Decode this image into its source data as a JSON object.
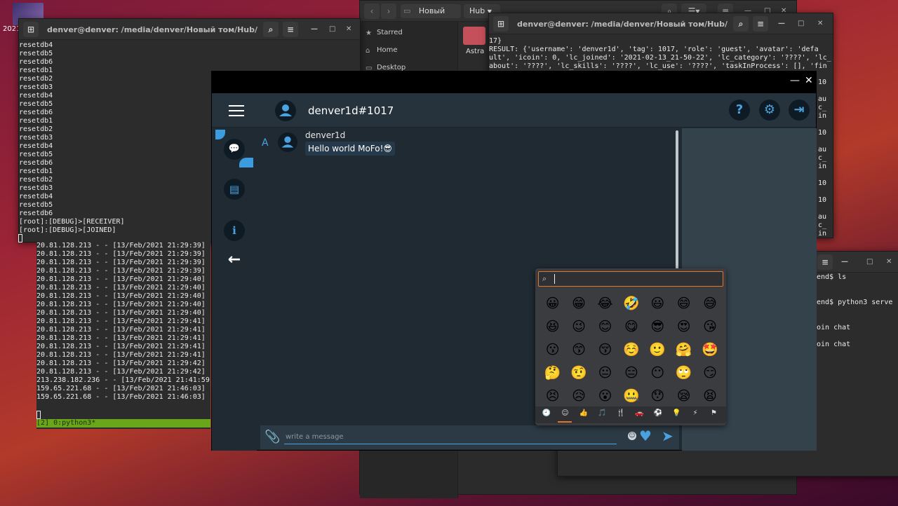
{
  "desktop": {
    "icon_label": "2021"
  },
  "terminal1": {
    "title": "denver@denver: /media/denver/Новый том/Hub/idenclin/cli...",
    "lines": [
      "resetdb4",
      "resetdb5",
      "resetdb6",
      "resetdb1",
      "resetdb2",
      "resetdb3",
      "resetdb4",
      "resetdb5",
      "resetdb6",
      "resetdb1",
      "resetdb2",
      "resetdb3",
      "resetdb4",
      "resetdb5",
      "resetdb6",
      "resetdb1",
      "resetdb2",
      "resetdb3",
      "resetdb4",
      "resetdb5",
      "resetdb6",
      "[root]:[DEBUG]>[RECEIVER]",
      "[root]:[DEBUG]>[JOINED]"
    ]
  },
  "terminal2": {
    "lines": [
      "20.81.128.213 - - [13/Feb/2021 21:29:39]",
      "20.81.128.213 - - [13/Feb/2021 21:29:39]",
      "20.81.128.213 - - [13/Feb/2021 21:29:39]",
      "20.81.128.213 - - [13/Feb/2021 21:29:39]",
      "20.81.128.213 - - [13/Feb/2021 21:29:40]",
      "20.81.128.213 - - [13/Feb/2021 21:29:40]",
      "20.81.128.213 - - [13/Feb/2021 21:29:40]",
      "20.81.128.213 - - [13/Feb/2021 21:29:40]",
      "20.81.128.213 - - [13/Feb/2021 21:29:40]",
      "20.81.128.213 - - [13/Feb/2021 21:29:41]",
      "20.81.128.213 - - [13/Feb/2021 21:29:41]",
      "20.81.128.213 - - [13/Feb/2021 21:29:41]",
      "20.81.128.213 - - [13/Feb/2021 21:29:41]",
      "20.81.128.213 - - [13/Feb/2021 21:29:41]",
      "20.81.128.213 - - [13/Feb/2021 21:29:42]",
      "20.81.128.213 - - [13/Feb/2021 21:29:42]",
      "213.238.182.236 - - [13/Feb/2021 21:41:59",
      "159.65.221.68 - - [13/Feb/2021 21:46:03]",
      "159.65.221.68 - - [13/Feb/2021 21:46:03]"
    ],
    "status": "[2] 0:python3*"
  },
  "filemanager": {
    "crumbs": [
      "Новый том",
      "Hub"
    ],
    "sidebar": [
      "Starred",
      "Home",
      "Desktop"
    ],
    "folder": "Astra"
  },
  "terminal3": {
    "title": "denver@denver: /media/denver/Новый том/Hub/idenclin/se...",
    "lines": [
      "17}",
      "RESULT: {'username': 'denver1d', 'tag': 1017, 'role': 'guest', 'avatar': 'defa",
      "ult', 'icoin': 0, 'lc_joined': '2021-02-13_21-50-22', 'lc_category': '????', 'lc_",
      "about': '????', 'lc_skills': '????', 'lc_use': '????', 'taskInProcess': [], 'fin"
    ],
    "side_lines": [
      "10",
      "au",
      "c_",
      "in",
      "10",
      "10",
      "au",
      "c_",
      "in",
      "10",
      "au",
      "c_",
      "in"
    ]
  },
  "terminal4": {
    "lines": [
      "end$ ls",
      "",
      "",
      "end$ python3 serve",
      "",
      "",
      "oin chat",
      "",
      "oin chat"
    ]
  },
  "chat": {
    "username": "denver1d#1017",
    "channel_letter": "A",
    "message": {
      "author": "denver1d",
      "text": "Hello world MoFo!😎"
    },
    "input_placeholder": "write a message",
    "icons": {
      "help": "?",
      "settings": "⚙",
      "logout": "⇥",
      "chat": "💬",
      "docs": "▤",
      "info": "i",
      "back": "←",
      "attach": "📎",
      "heart": "♥",
      "send": "➤",
      "minimize": "—",
      "close": "✕"
    },
    "accent": "#4aa3e0"
  },
  "emoji_picker": {
    "emojis": [
      "😀",
      "😁",
      "😂",
      "🤣",
      "😃",
      "😄",
      "😅",
      "😆",
      "😉",
      "😊",
      "😋",
      "😎",
      "😍",
      "😘",
      "😗",
      "😙",
      "😚",
      "☺️",
      "🙂",
      "🤗",
      "🤩",
      "🤔",
      "🤨",
      "😐",
      "😑",
      "😶",
      "🙄",
      "😏",
      "😣",
      "😥",
      "😮",
      "🤐",
      "😯",
      "😪",
      "😫"
    ],
    "categories": [
      "🕘",
      "☺",
      "👍",
      "🎵",
      "🍴",
      "🚗",
      "⚽",
      "💡",
      "⚡",
      "⚑"
    ]
  }
}
